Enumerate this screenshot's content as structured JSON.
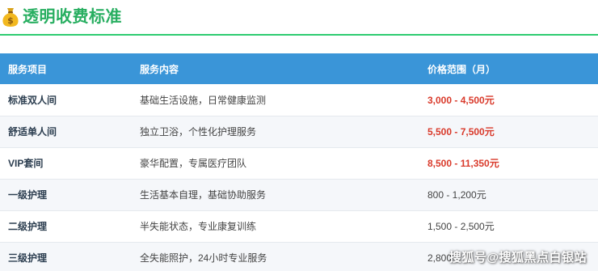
{
  "header": {
    "icon": "money-bag-icon",
    "title": "透明收费标准",
    "accent_color": "#27ae60"
  },
  "table": {
    "header_color": "#3a95d8",
    "highlight_color": "#d93a2b",
    "columns": [
      "服务项目",
      "服务内容",
      "价格范围（月）"
    ],
    "rows": [
      {
        "item": "标准双人间",
        "content": "基础生活设施，日常健康监测",
        "price": "3,000 - 4,500元",
        "highlight": true
      },
      {
        "item": "舒适单人间",
        "content": "独立卫浴，个性化护理服务",
        "price": "5,500 - 7,500元",
        "highlight": true
      },
      {
        "item": "VIP套间",
        "content": "豪华配置，专属医疗团队",
        "price": "8,500 - 11,350元",
        "highlight": true
      },
      {
        "item": "一级护理",
        "content": "生活基本自理，基础协助服务",
        "price": "800 - 1,200元",
        "highlight": false
      },
      {
        "item": "二级护理",
        "content": "半失能状态，专业康复训练",
        "price": "1,500 - 2,500元",
        "highlight": false
      },
      {
        "item": "三级护理",
        "content": "全失能照护，24小时专业服务",
        "price": "2,800",
        "highlight": false
      }
    ]
  },
  "watermark": {
    "text": "搜狐号@搜狐黑点白银站"
  }
}
